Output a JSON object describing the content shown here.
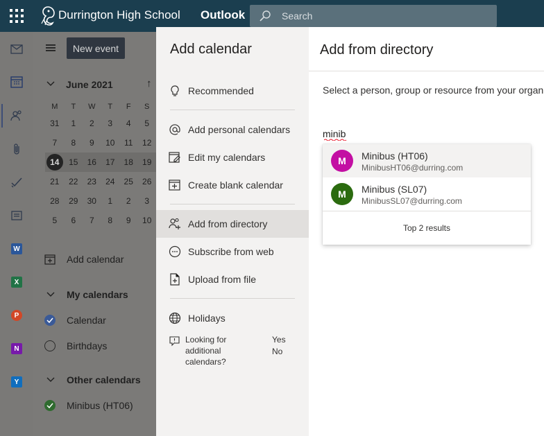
{
  "header": {
    "org_name": "Durrington High School",
    "app_name": "Outlook",
    "search_placeholder": "Search",
    "colors": {
      "header_bg": "#1b3e4f",
      "search_bg": "#5a707b"
    }
  },
  "rail": {
    "items": [
      {
        "name": "mail-icon"
      },
      {
        "name": "calendar-icon",
        "active": true
      },
      {
        "name": "people-icon"
      },
      {
        "name": "attach-icon"
      },
      {
        "name": "todo-icon"
      },
      {
        "name": "groups-icon"
      },
      {
        "name": "word-icon",
        "letter": "W",
        "color": "#2b579a"
      },
      {
        "name": "excel-icon",
        "letter": "X",
        "color": "#217346"
      },
      {
        "name": "powerpoint-icon",
        "letter": "P",
        "color": "#d24726"
      },
      {
        "name": "onenote-icon",
        "letter": "N",
        "color": "#7719aa"
      },
      {
        "name": "yammer-icon",
        "letter": "Y",
        "color": "#106ebe"
      }
    ]
  },
  "calendar_pane": {
    "new_event_label": "New event",
    "month_label": "June 2021",
    "weekdays": [
      "M",
      "T",
      "W",
      "T",
      "F",
      "S"
    ],
    "weeks": [
      [
        "31",
        "1",
        "2",
        "3",
        "4",
        "5"
      ],
      [
        "7",
        "8",
        "9",
        "10",
        "11",
        "12"
      ],
      [
        "14",
        "15",
        "16",
        "17",
        "18",
        "19"
      ],
      [
        "21",
        "22",
        "23",
        "24",
        "25",
        "26"
      ],
      [
        "28",
        "29",
        "30",
        "1",
        "2",
        "3"
      ],
      [
        "5",
        "6",
        "7",
        "8",
        "9",
        "10"
      ]
    ],
    "today": "14",
    "add_calendar_label": "Add calendar",
    "my_calendars_label": "My calendars",
    "my_calendars": [
      {
        "label": "Calendar",
        "checked": true,
        "color": "#3a5a98"
      },
      {
        "label": "Birthdays",
        "checked": false
      }
    ],
    "other_calendars_label": "Other calendars",
    "other_calendars": [
      {
        "label": "Minibus (HT06)",
        "checked": true,
        "color": "#2f6b2f"
      }
    ]
  },
  "dialog": {
    "title": "Add calendar",
    "nav": {
      "recommended": "Recommended",
      "add_personal": "Add personal calendars",
      "edit_my": "Edit my calendars",
      "create_blank": "Create blank calendar",
      "add_directory": "Add from directory",
      "subscribe_web": "Subscribe from web",
      "upload_file": "Upload from file",
      "holidays": "Holidays"
    },
    "selected_item": "Add from directory",
    "feedback_question": "Looking for additional calendars?",
    "feedback_yes": "Yes",
    "feedback_no": "No"
  },
  "directory": {
    "title": "Add from directory",
    "description": "Select a person, group or resource from your organi",
    "input_value": "minib",
    "results": [
      {
        "initial": "M",
        "name": "Minibus (HT06)",
        "email": "MinibusHT06@durring.com",
        "color": "#c30fa3"
      },
      {
        "initial": "M",
        "name": "Minibus (SL07)",
        "email": "MinibusSL07@durring.com",
        "color": "#2b6b0f"
      }
    ],
    "footer": "Top 2 results"
  }
}
